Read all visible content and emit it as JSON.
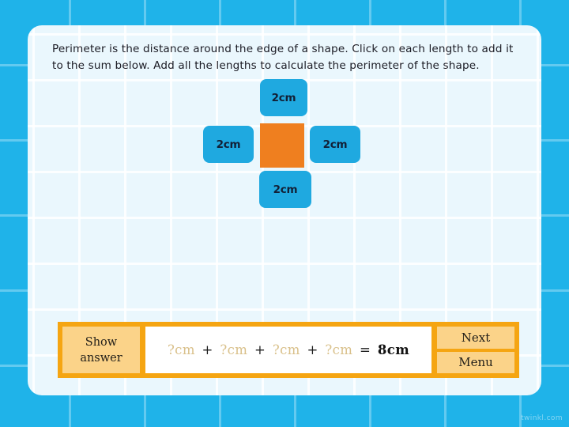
{
  "activity": {
    "instructions": "Perimeter is the distance around the edge of a shape. Click on each length to add it to the sum below. Add all the lengths to calculate the perimeter of the shape.",
    "shape": {
      "name": "square",
      "fill_color": "#ef7f1f",
      "label_color": "#1fa9e0",
      "sides": [
        {
          "position": "top",
          "label": "2cm"
        },
        {
          "position": "left",
          "label": "2cm"
        },
        {
          "position": "right",
          "label": "2cm"
        },
        {
          "position": "bottom",
          "label": "2cm"
        }
      ]
    },
    "sum": {
      "terms": [
        "?cm",
        "?cm",
        "?cm",
        "?cm"
      ],
      "operator": "+",
      "equals": "=",
      "result": "8cm",
      "unknown_color": "#d9c08a"
    },
    "controls": {
      "show_answer_line1": "Show",
      "show_answer_line2": "answer",
      "next_label": "Next",
      "menu_label": "Menu",
      "bar_color": "#f5a512",
      "button_color": "#fbd389"
    }
  },
  "watermark": "twinkl.com"
}
